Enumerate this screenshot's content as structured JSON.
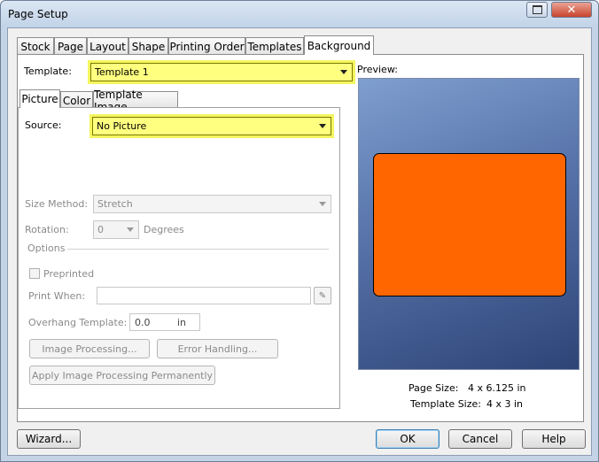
{
  "window": {
    "title": "Page Setup"
  },
  "tabs": [
    "Stock",
    "Page",
    "Layout",
    "Shape",
    "Printing Order",
    "Templates",
    "Background"
  ],
  "template": {
    "label": "Template:",
    "value": "Template 1"
  },
  "subtabs": [
    "Picture",
    "Color",
    "Template Image"
  ],
  "picture": {
    "source_label": "Source:",
    "source_value": "No Picture",
    "size_method_label": "Size Method:",
    "size_method_value": "Stretch",
    "rotation_label": "Rotation:",
    "rotation_value": "0",
    "degrees_label": "Degrees",
    "options_label": "Options",
    "preprinted_label": "Preprinted",
    "print_when_label": "Print When:",
    "print_when_value": "",
    "overhang_label": "Overhang Template:",
    "overhang_value": "0.0",
    "overhang_unit": "in",
    "image_processing_btn": "Image Processing...",
    "error_handling_btn": "Error Handling...",
    "apply_btn": "Apply Image Processing Permanently"
  },
  "preview": {
    "label": "Preview:",
    "page_size_label": "Page Size:",
    "page_size_value": "4 x 6.125 in",
    "template_size_label": "Template Size:",
    "template_size_value": "4 x 3 in"
  },
  "buttons": {
    "wizard": "Wizard...",
    "ok": "OK",
    "cancel": "Cancel",
    "help": "Help"
  },
  "colors": {
    "highlight": "#ffff80",
    "preview_shape": "#ff6600",
    "preview_bg": "#5672a8"
  }
}
